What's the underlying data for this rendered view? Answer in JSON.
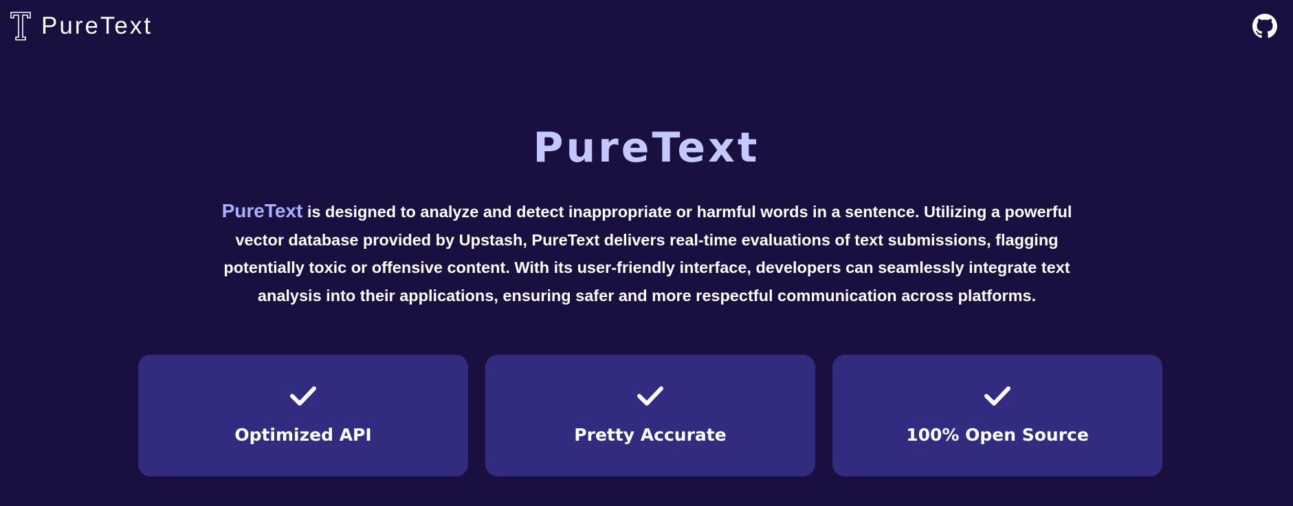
{
  "navbar": {
    "brand_name": "PureText",
    "logo_icon": "letter-t-logo-icon",
    "github_icon": "github-icon"
  },
  "hero": {
    "title": "PureText",
    "desc_highlight": "PureText",
    "desc_rest": " is designed to analyze and detect inappropriate or harmful words in a sentence. Utilizing a powerful vector database provided by Upstash, PureText delivers real-time evaluations of text submissions, flagging potentially toxic or offensive content. With its user-friendly interface, developers can seamlessly integrate text analysis into their applications, ensuring safer and more respectful communication across platforms."
  },
  "features": [
    {
      "icon": "checkmark-icon",
      "label": "Optimized API"
    },
    {
      "icon": "checkmark-icon",
      "label": "Pretty Accurate"
    },
    {
      "icon": "checkmark-icon",
      "label": "100% Open Source"
    }
  ],
  "colors": {
    "background": "#1a1040",
    "card": "#322c80",
    "title": "#c3c8ff",
    "highlight": "#a6b0ff"
  }
}
